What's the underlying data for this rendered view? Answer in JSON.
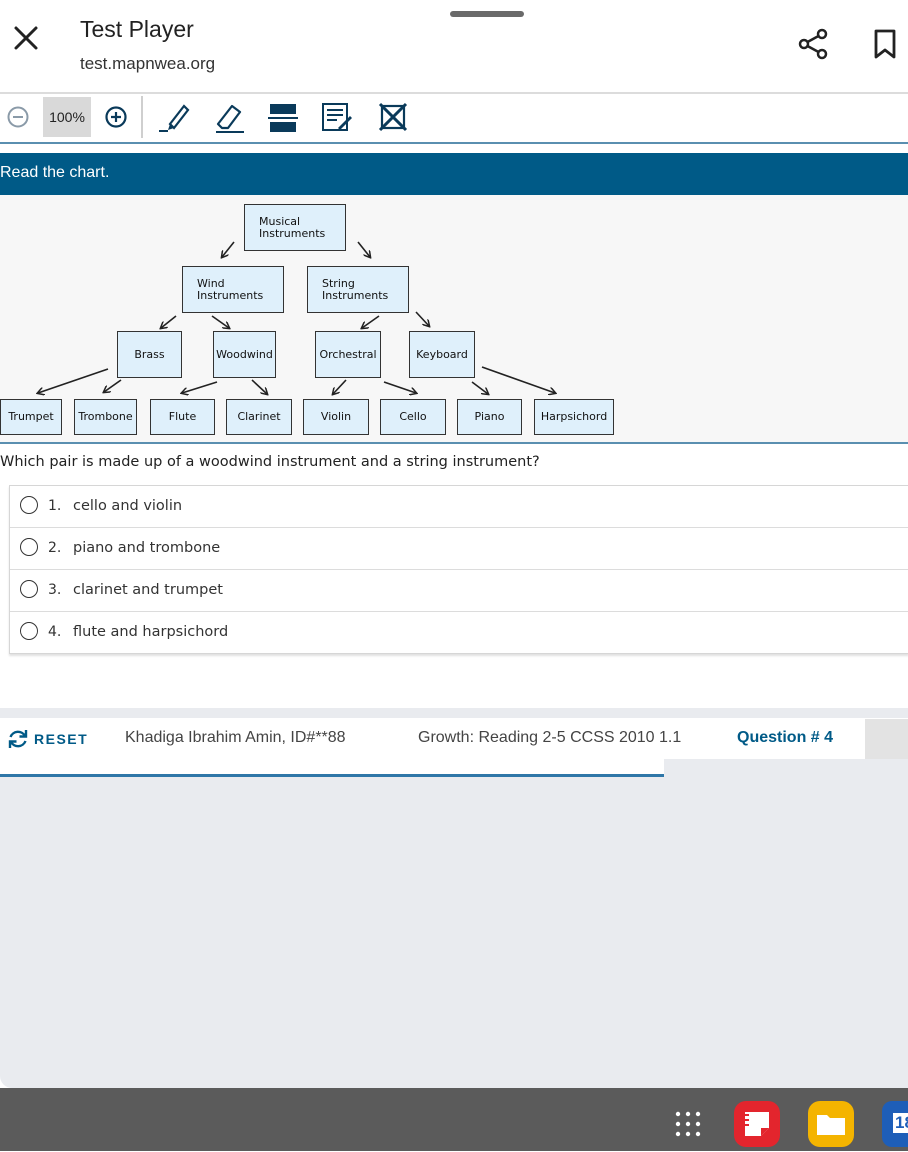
{
  "browser": {
    "title": "Test Player",
    "url": "test.mapnwea.org"
  },
  "toolbar": {
    "zoom_level": "100%",
    "icons": [
      "zoom-out-icon",
      "zoom-in-icon",
      "highlighter-icon",
      "eraser-icon",
      "line-reader-icon",
      "notepad-icon",
      "answer-eliminator-icon"
    ]
  },
  "passage": {
    "instruction": "Read the chart."
  },
  "chart": {
    "root": "Musical\nInstruments",
    "level1": [
      "Wind\nInstruments",
      "String\nInstruments"
    ],
    "level2": [
      "Brass",
      "Woodwind",
      "Orchestral",
      "Keyboard"
    ],
    "leaves": [
      "Trumpet",
      "Trombone",
      "Flute",
      "Clarinet",
      "Violin",
      "Cello",
      "Piano",
      "Harpsichord"
    ]
  },
  "question": {
    "text": "Which pair is made up of a woodwind instrument and a string instrument?",
    "options": [
      {
        "num": "1.",
        "text": "cello and violin"
      },
      {
        "num": "2.",
        "text": "piano and trombone"
      },
      {
        "num": "3.",
        "text": "clarinet and trumpet"
      },
      {
        "num": "4.",
        "text": "flute and harpsichord"
      }
    ]
  },
  "footer": {
    "reset_label": "RESET",
    "student": "Khadiga Ibrahim Amin, ID#**88",
    "test_name": "Growth: Reading 2-5 CCSS 2010 1.1",
    "question_number": "Question # 4"
  },
  "navbar": {
    "calendar_day": "18"
  },
  "colors": {
    "accent": "#005a87",
    "node_fill": "#dff0fb",
    "divider": "#5a8fb0"
  }
}
